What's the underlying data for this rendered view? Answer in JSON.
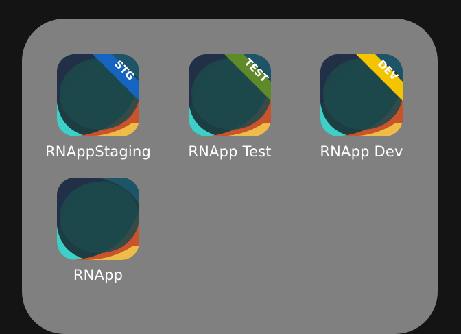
{
  "apps": [
    {
      "label": "RNAppStaging",
      "badge": "STG",
      "badge_color": "#1565c0"
    },
    {
      "label": "RNApp Test",
      "badge": "TEST",
      "badge_color": "#5f8a2a"
    },
    {
      "label": "RNApp Dev",
      "badge": "DEV",
      "badge_color": "#f5c400"
    },
    {
      "label": "RNApp",
      "badge": "",
      "badge_color": ""
    }
  ],
  "colors": {
    "folder_bg": "#808080",
    "screen_bg": "#141414",
    "icon_dark": "#1c3d42",
    "icon_teal": "#3ecfc6",
    "icon_orange": "#c9532a",
    "icon_yellow": "#f2c94c",
    "icon_navy": "#223047"
  }
}
